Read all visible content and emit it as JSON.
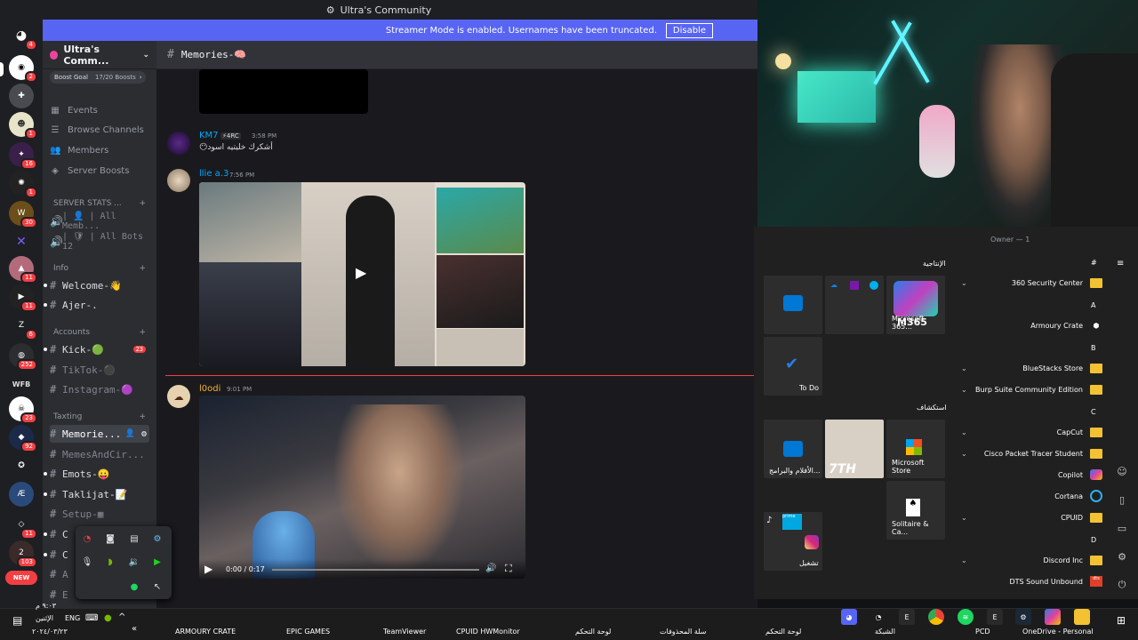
{
  "title_bar": {
    "title": "Ultra's Community"
  },
  "banner": {
    "text": "Streamer Mode is enabled. Usernames have been truncated.",
    "button": "Disable"
  },
  "server": {
    "name": "Ultra's Comm...",
    "boost_label": "Boost Goal",
    "boost_value": "17/20 Boosts"
  },
  "rail": {
    "badges": [
      "4",
      "2",
      "1",
      "1",
      "16",
      "1",
      "30",
      "11",
      "11",
      "6",
      "252",
      "23",
      "92",
      "11",
      "103"
    ],
    "labels": [
      "WFB",
      "NEW"
    ]
  },
  "nav": [
    {
      "label": "Events",
      "icon": "calendar-icon"
    },
    {
      "label": "Browse Channels",
      "icon": "browse-icon"
    },
    {
      "label": "Members",
      "icon": "members-icon"
    },
    {
      "label": "Server Boosts",
      "icon": "boost-icon"
    }
  ],
  "categories": {
    "server_stats": "SERVER STATS ...",
    "info": "Info",
    "accounts": "Accounts",
    "taxting": "Taxting"
  },
  "channels": {
    "all_members": "| 👤 | All Memb...",
    "all_bots": "| 🛡 | All Bots 12",
    "welcome": "Welcome-👋",
    "ajer": "Ajer-.",
    "kick": "Kick-🟢",
    "kick_badge": "23",
    "tiktok": "TikTok-⚫",
    "instagram": "Instagram-🟣",
    "memories": "Memorie...",
    "memes": "MemesAndCir...",
    "emots": "Emots-😛",
    "taklijat": "Taklijat-📝",
    "setup": "Setup-▦",
    "c1": "C",
    "c2": "C",
    "a1": "A",
    "e1": "E"
  },
  "chat": {
    "header": "Memories-🧠",
    "messages": [
      {
        "user": "KM7",
        "tag": "⚡4RC",
        "time": "3:58 PM",
        "text": "😶أشكرك خليتيه اسود"
      },
      {
        "user": "llie a.3",
        "time": "7:56 PM"
      },
      {
        "user": "l0odi",
        "time": "9:01 PM",
        "video_time": "0:00 / 0:17"
      }
    ]
  },
  "start_menu": {
    "owner": "Owner — 1",
    "pinned_title": "الإنتاجية",
    "explore_title": "استكشاف",
    "tiles": {
      "m365": "Microsoft 365...",
      "m365_badge": "M365",
      "todo": "To Do",
      "movies": "الأفلام والبرامج...",
      "msstore": "Microsoft Store",
      "solitaire": "Solitaire & Ca...",
      "play": "تشغيل",
      "tnl": "7TH"
    },
    "letters": [
      "#",
      "A",
      "B",
      "C",
      "D"
    ],
    "apps": [
      "360 Security Center",
      "Armoury Crate",
      "BlueStacks Store",
      "Burp Suite Community Edition",
      "CapCut",
      "Cisco Packet Tracer Student",
      "Copilot",
      "Cortana",
      "CPUID",
      "Discord Inc",
      "DTS Sound Unbound"
    ]
  },
  "taskbar": {
    "clock_time": "٩:٠٣ م",
    "clock_day": "الإثنين",
    "clock_date": "٢٠٢٤/٠٣/٢٣",
    "lang": "ENG",
    "items": [
      "ARMOURY CRATE",
      "EPIC GAMES",
      "TeamViewer",
      "CPUID HWMonitor",
      "لوحة التحكم",
      "سلة المحذوفات",
      "لوحة التحكم",
      "الشبكة",
      "PCD",
      "OneDrive - Personal"
    ]
  },
  "colors": {
    "blurple": "#5865f2",
    "kick_green": "#1ed31e",
    "folder": "#f2c233",
    "badge_red": "#f23f43",
    "username_blue": "#00a8fc",
    "username_orange": "#f0b132"
  }
}
